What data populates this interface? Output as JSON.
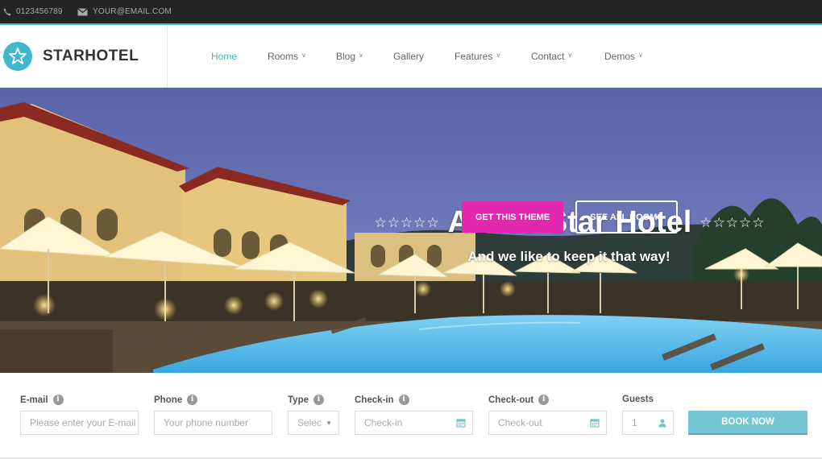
{
  "topbar": {
    "phone": "0123456789",
    "email": "YOUR@EMAIL.COM"
  },
  "logo": {
    "text": "STARHOTEL",
    "icon": "star-icon"
  },
  "nav": [
    {
      "label": "Home",
      "active": true,
      "dropdown": false
    },
    {
      "label": "Rooms",
      "active": false,
      "dropdown": true
    },
    {
      "label": "Blog",
      "active": false,
      "dropdown": true
    },
    {
      "label": "Gallery",
      "active": false,
      "dropdown": false
    },
    {
      "label": "Features",
      "active": false,
      "dropdown": true
    },
    {
      "label": "Contact",
      "active": false,
      "dropdown": true
    },
    {
      "label": "Demos",
      "active": false,
      "dropdown": true
    }
  ],
  "hero": {
    "stars_left": "☆☆☆☆☆",
    "title": "A Five Star Hotel",
    "stars_right": "☆☆☆☆☆",
    "subtitle": "And we like to keep it that way!",
    "primary_button": "GET THIS THEME",
    "secondary_button": "SEE ALL ROOMS"
  },
  "booking": {
    "email": {
      "label": "E-mail",
      "placeholder": "Please enter your E-mail"
    },
    "phone": {
      "label": "Phone",
      "placeholder": "Your phone number"
    },
    "type": {
      "label": "Type",
      "placeholder": "Select"
    },
    "checkin": {
      "label": "Check-in",
      "placeholder": "Check-in"
    },
    "checkout": {
      "label": "Check-out",
      "placeholder": "Check-out"
    },
    "guests": {
      "label": "Guests",
      "value": "1"
    },
    "submit": "BOOK NOW"
  },
  "colors": {
    "accent": "#41b7cb",
    "primary_button": "#e228ae",
    "book_button": "#74c6d4",
    "topbar": "#222426"
  }
}
